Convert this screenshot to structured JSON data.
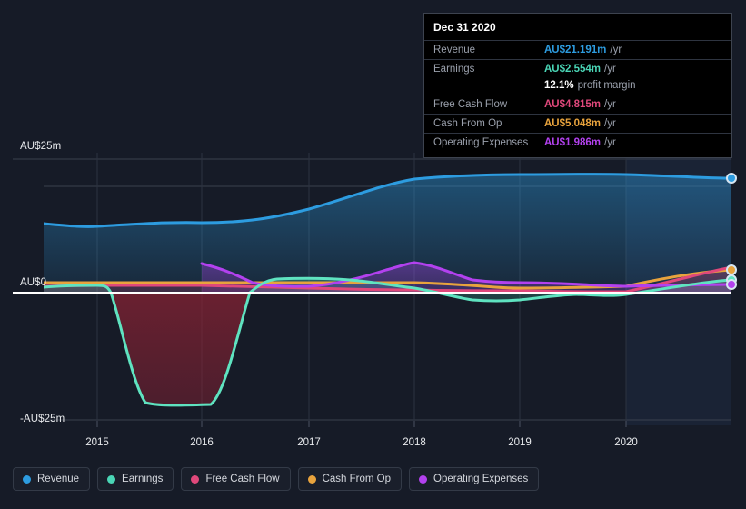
{
  "background": "#161b27",
  "axis": {
    "y_top_label": "AU$25m",
    "y_zero_label": "AU$0",
    "y_bottom_label": "-AU$25m",
    "x_ticks": [
      "2015",
      "2016",
      "2017",
      "2018",
      "2019",
      "2020"
    ]
  },
  "tooltip": {
    "date": "Dec 31 2020",
    "rows": [
      {
        "key": "Revenue",
        "value": "AU$21.191m",
        "suffix": "/yr",
        "color": "#2d9ce0"
      },
      {
        "key": "Earnings",
        "value": "AU$2.554m",
        "suffix": "/yr",
        "color": "#4ad6b6"
      },
      {
        "key": "",
        "value": "12.1%",
        "suffix": "profit margin",
        "color": "#ffffff"
      },
      {
        "key": "Free Cash Flow",
        "value": "AU$4.815m",
        "suffix": "/yr",
        "color": "#e0487b"
      },
      {
        "key": "Cash From Op",
        "value": "AU$5.048m",
        "suffix": "/yr",
        "color": "#e8a33d"
      },
      {
        "key": "Operating Expenses",
        "value": "AU$1.986m",
        "suffix": "/yr",
        "color": "#b341ef"
      }
    ]
  },
  "legend": [
    {
      "label": "Revenue",
      "color": "#2d9ce0"
    },
    {
      "label": "Earnings",
      "color": "#4ad6b6"
    },
    {
      "label": "Free Cash Flow",
      "color": "#e0487b"
    },
    {
      "label": "Cash From Op",
      "color": "#e8a33d"
    },
    {
      "label": "Operating Expenses",
      "color": "#b341ef"
    }
  ],
  "chart_data": {
    "type": "area",
    "title": "",
    "xlabel": "",
    "ylabel": "AU$",
    "ylim": [
      -25,
      25
    ],
    "yticks": [
      25,
      0,
      -25
    ],
    "ytick_labels": [
      "AU$25m",
      "AU$0",
      "-AU$25m"
    ],
    "xlim": [
      "2014-07",
      "2021-03"
    ],
    "x_categories": [
      "2015",
      "2016",
      "2017",
      "2018",
      "2019",
      "2020"
    ],
    "grid": true,
    "legend_position": "bottom",
    "currency": "AU$",
    "units": "millions per year",
    "forecast_region_starts": "2020",
    "series": [
      {
        "name": "Revenue",
        "color": "#2d9ce0",
        "x": [
          "2014-07",
          "2015",
          "2015-07",
          "2016",
          "2016-07",
          "2017",
          "2017-07",
          "2018",
          "2018-07",
          "2019",
          "2019-07",
          "2020",
          "2020-07",
          "2021-03"
        ],
        "values": [
          12.9,
          12.4,
          12.1,
          12.0,
          12.4,
          13.7,
          15.6,
          17.8,
          19.0,
          19.2,
          19.6,
          20.0,
          20.4,
          21.191
        ]
      },
      {
        "name": "Earnings",
        "color": "#4ad6b6",
        "x": [
          "2014-07",
          "2015",
          "2015-07",
          "2016",
          "2016-07",
          "2017",
          "2017-07",
          "2018",
          "2018-07",
          "2019",
          "2019-07",
          "2020",
          "2020-07",
          "2021-03"
        ],
        "values": [
          1.0,
          0.7,
          -23.5,
          -23.6,
          1.9,
          2.0,
          1.9,
          1.1,
          -0.6,
          -1.2,
          -0.7,
          0.1,
          1.3,
          2.554
        ]
      },
      {
        "name": "Free Cash Flow",
        "color": "#e0487b",
        "x": [
          "2014-07",
          "2015",
          "2015-07",
          "2016",
          "2016-07",
          "2017",
          "2017-07",
          "2018",
          "2018-07",
          "2019",
          "2019-07",
          "2020",
          "2020-07",
          "2021-03"
        ],
        "values": [
          1.2,
          1.3,
          1.4,
          1.4,
          1.1,
          1.0,
          0.9,
          0.5,
          0.1,
          0.4,
          0.2,
          0.2,
          2.0,
          4.815
        ]
      },
      {
        "name": "Cash From Op",
        "color": "#e8a33d",
        "x": [
          "2014-07",
          "2015",
          "2015-07",
          "2016",
          "2016-07",
          "2017",
          "2017-07",
          "2018",
          "2018-07",
          "2019",
          "2019-07",
          "2020",
          "2020-07",
          "2021-03"
        ],
        "values": [
          1.8,
          1.8,
          1.8,
          1.8,
          1.7,
          1.8,
          1.8,
          1.7,
          1.3,
          1.0,
          0.9,
          1.0,
          3.1,
          5.048
        ]
      },
      {
        "name": "Operating Expenses",
        "color": "#b341ef",
        "x": [
          "2016",
          "2016-07",
          "2017",
          "2017-07",
          "2018",
          "2018-07",
          "2019",
          "2019-07",
          "2020",
          "2020-07",
          "2021-03"
        ],
        "values": [
          5.4,
          3.0,
          1.2,
          2.8,
          5.8,
          4.2,
          2.2,
          2.0,
          1.2,
          1.8,
          1.986
        ]
      }
    ]
  }
}
